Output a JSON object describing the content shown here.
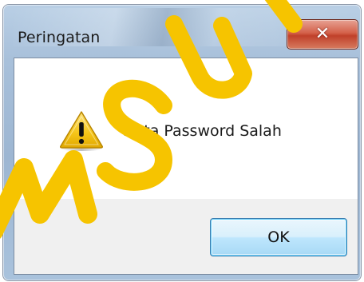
{
  "dialog": {
    "title": "Peringatan",
    "message": "Data Password Salah",
    "ok_label": "OK",
    "close_glyph": "✕",
    "icon": "warning-icon"
  },
  "watermark": {
    "text": "MSUI",
    "color": "#f6c400"
  },
  "colors": {
    "frame": "#a8c0da",
    "close_button": "#c7472f",
    "ok_button_border": "#3c7fb1",
    "warning_fill": "#f5c518"
  }
}
